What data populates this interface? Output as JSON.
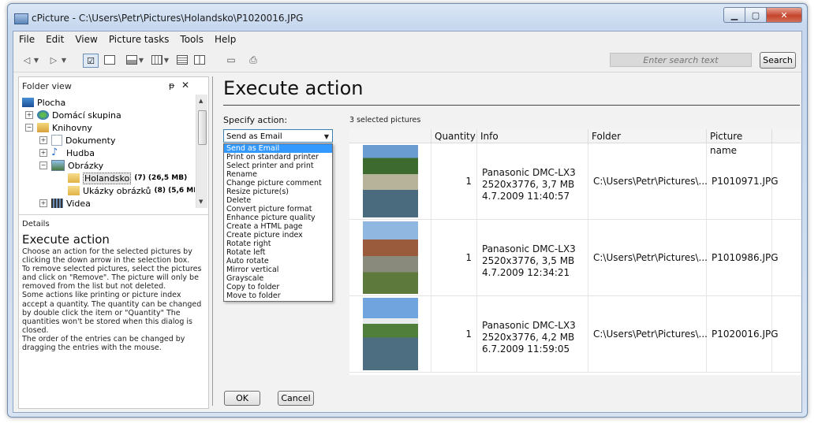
{
  "window": {
    "title": "cPicture - C:\\Users\\Petr\\Pictures\\Holandsko\\P1020016.JPG"
  },
  "menu": [
    "File",
    "Edit",
    "View",
    "Picture tasks",
    "Tools",
    "Help"
  ],
  "toolbar": {
    "search_placeholder": "Enter search text",
    "search_button": "Search"
  },
  "folder_view": {
    "title": "Folder view",
    "pin": "ᵽ",
    "close": "✕",
    "items": [
      {
        "label": "Plocha",
        "extra": ""
      },
      {
        "label": "Domácí skupina",
        "extra": ""
      },
      {
        "label": "Knihovny",
        "extra": ""
      },
      {
        "label": "Dokumenty",
        "extra": ""
      },
      {
        "label": "Hudba",
        "extra": ""
      },
      {
        "label": "Obrázky",
        "extra": ""
      },
      {
        "label": "Holandsko",
        "extra": "(7) (26,5 MB)"
      },
      {
        "label": "Ukázky obrázků",
        "extra": "(8) (5,6 MB)"
      },
      {
        "label": "Videa",
        "extra": ""
      }
    ]
  },
  "details": {
    "label": "Details",
    "title": "Execute action",
    "text": "Choose an action for the selected pictures by clicking the down arrow in the selection box.\nTo remove selected pictures, select the pictures and click on \"Remove\". The picture will only be removed from the list but not deleted.\nSome actions like printing or picture index accept a quantity. The quantity can be changed by double click the item or \"Quantity\" The quantities won't be stored when this dialog is closed.\nThe order of the entries can be changed by dragging the entries with the mouse."
  },
  "main": {
    "title": "Execute action",
    "specify_label": "Specify action:",
    "selected_action": "Send as Email",
    "actions": [
      "Send as Email",
      "Print on standard printer",
      "Select printer and print",
      "Rename",
      "Change picture comment",
      "Resize picture(s)",
      "Delete",
      "Convert picture format",
      "Enhance picture quality",
      "Create a HTML page",
      "Create picture index",
      "Rotate right",
      "Rotate left",
      "Auto rotate",
      "Mirror vertical",
      "Grayscale",
      "Copy to folder",
      "Move to folder"
    ],
    "selected_count": "3 selected pictures",
    "columns": {
      "quantity": "Quantity",
      "info": "Info",
      "folder": "Folder",
      "name": "Picture name"
    },
    "rows": [
      {
        "qty": "1",
        "camera": "Panasonic DMC-LX3",
        "size": "2520x3776, 3,7 MB",
        "date": "4.7.2009 11:40:57",
        "folder": "C:\\Users\\Petr\\Pictures\\...",
        "name": "P1010971.JPG"
      },
      {
        "qty": "1",
        "camera": "Panasonic DMC-LX3",
        "size": "2520x3776, 3,5 MB",
        "date": "4.7.2009 12:34:21",
        "folder": "C:\\Users\\Petr\\Pictures\\...",
        "name": "P1010986.JPG"
      },
      {
        "qty": "1",
        "camera": "Panasonic DMC-LX3",
        "size": "2520x3776, 4,2 MB",
        "date": "6.7.2009 11:59:05",
        "folder": "C:\\Users\\Petr\\Pictures\\...",
        "name": "P1020016.JPG"
      }
    ],
    "ok": "OK",
    "cancel": "Cancel"
  }
}
